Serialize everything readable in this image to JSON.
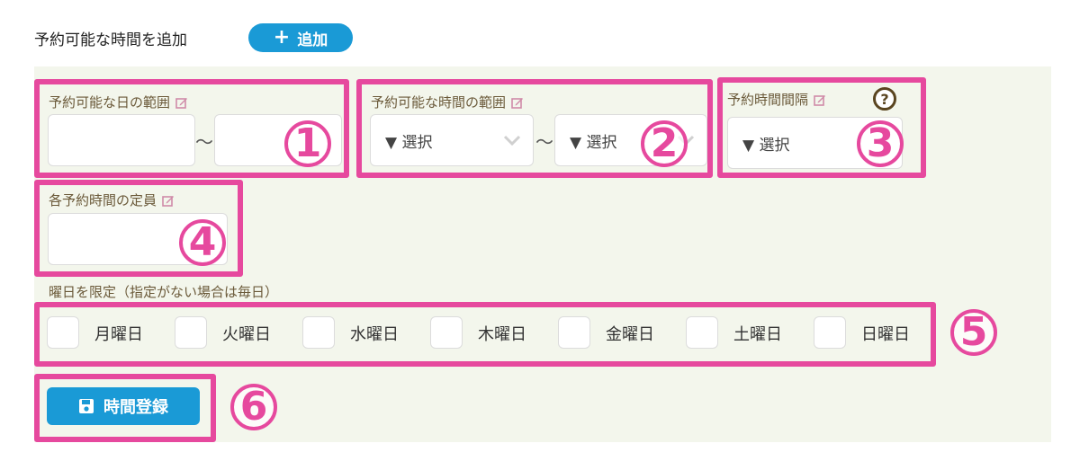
{
  "header": {
    "title": "予約可能な時間を追加",
    "add_button_label": "追加"
  },
  "date_range": {
    "label": "予約可能な日の範囲",
    "separator": "～",
    "start_value": "",
    "end_value": ""
  },
  "time_range": {
    "label": "予約可能な時間の範囲",
    "separator": "～",
    "start_select": "▼ 選択",
    "end_select": "▼ 選択"
  },
  "interval": {
    "label": "予約時間間隔",
    "select": "▼ 選択",
    "help_glyph": "?"
  },
  "capacity": {
    "label": "各予約時間の定員",
    "value": ""
  },
  "weekdays": {
    "label": "曜日を限定（指定がない場合は毎日）",
    "days": [
      "月曜日",
      "火曜日",
      "水曜日",
      "木曜日",
      "金曜日",
      "土曜日",
      "日曜日"
    ]
  },
  "save_button_label": "時間登録",
  "callouts": [
    "1",
    "2",
    "3",
    "4",
    "5",
    "6"
  ],
  "colors": {
    "accent_blue": "#1a9ad6",
    "highlight_pink": "#e6499e",
    "panel_bg": "#f3f6ec"
  }
}
